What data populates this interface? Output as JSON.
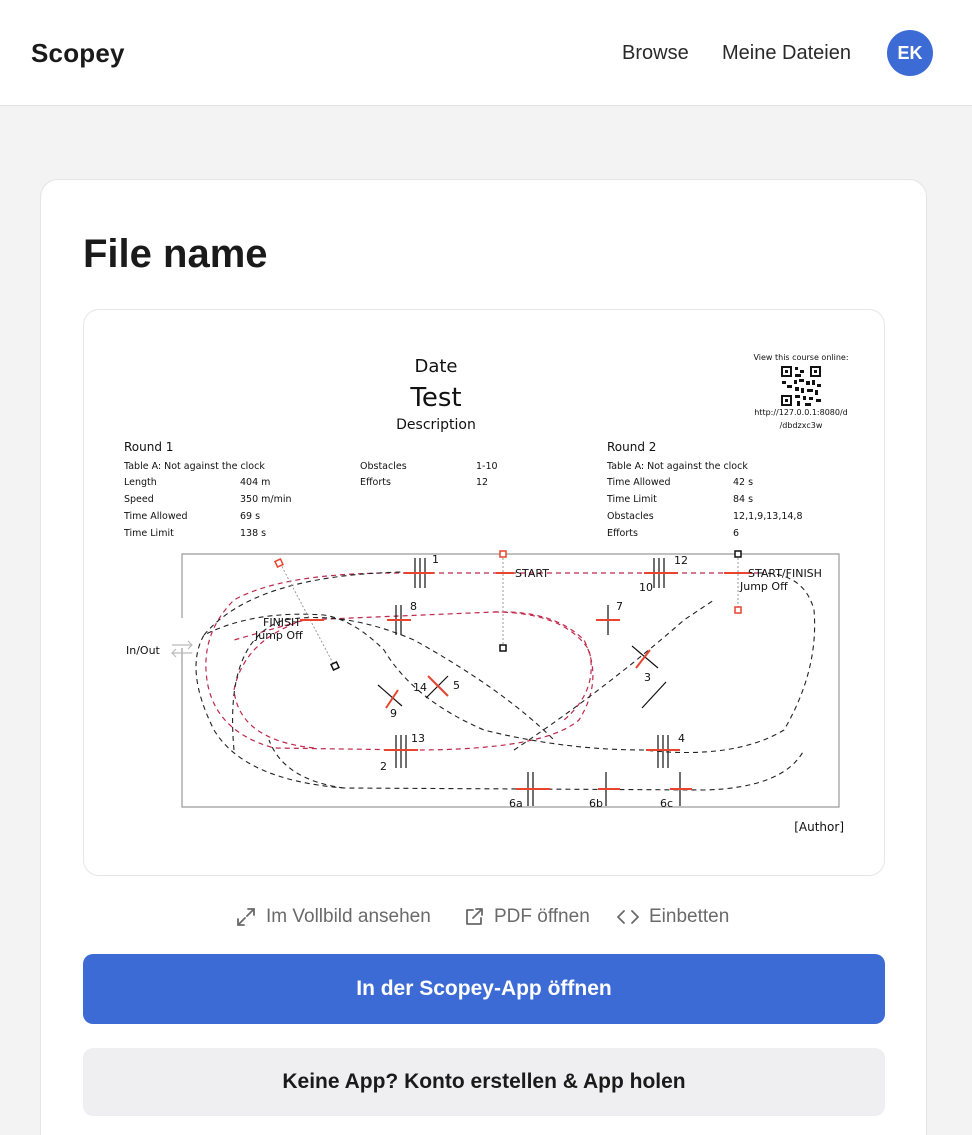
{
  "header": {
    "brand": "Scopey",
    "nav": {
      "browse": "Browse",
      "files": "Meine Dateien"
    },
    "avatar_initials": "EK"
  },
  "file": {
    "title": "File name"
  },
  "course": {
    "date": "Date",
    "title": "Test",
    "description": "Description",
    "online_label": "View this course online:",
    "url_line1": "http://127.0.0.1:8080/d",
    "url_line2": "/dbdzxc3w",
    "round1": {
      "title": "Round 1",
      "table": "Table A: Not against the clock",
      "rows": [
        {
          "label": "Length",
          "value": "404 m"
        },
        {
          "label": "Speed",
          "value": "350 m/min"
        },
        {
          "label": "Time Allowed",
          "value": "69 s"
        },
        {
          "label": "Time Limit",
          "value": "138 s"
        }
      ],
      "obstacles_label": "Obstacles",
      "obstacles_value": "1-10",
      "efforts_label": "Efforts",
      "efforts_value": "12"
    },
    "round2": {
      "title": "Round 2",
      "table": "Table A: Not against the clock",
      "rows": [
        {
          "label": "Time Allowed",
          "value": "42 s"
        },
        {
          "label": "Time Limit",
          "value": "84 s"
        },
        {
          "label": "Obstacles",
          "value": "12,1,9,13,14,8"
        },
        {
          "label": "Efforts",
          "value": "6"
        }
      ]
    },
    "labels": {
      "in_out": "In/Out",
      "start": "START",
      "finish": "FINISH",
      "jump_off": "Jump Off",
      "start_finish": "START/FINISH",
      "author": "[Author]"
    },
    "obstacles": [
      "1",
      "2",
      "3",
      "4",
      "5",
      "6a",
      "6b",
      "6c",
      "7",
      "8",
      "9",
      "10",
      "12",
      "13",
      "14"
    ]
  },
  "actions": {
    "fullscreen": "Im Vollbild ansehen",
    "pdf": "PDF öffnen",
    "embed": "Einbetten"
  },
  "buttons": {
    "open_app": "In der Scopey-App öffnen",
    "no_app": "Keine App? Konto erstellen & App holen"
  },
  "colors": {
    "accent": "#3d6bd6",
    "route_red": "#c0284a",
    "jump_red": "#e8442e"
  },
  "icons": [
    "expand-icon",
    "external-link-icon",
    "code-icon",
    "swap-arrows-icon",
    "qr-code-icon"
  ]
}
